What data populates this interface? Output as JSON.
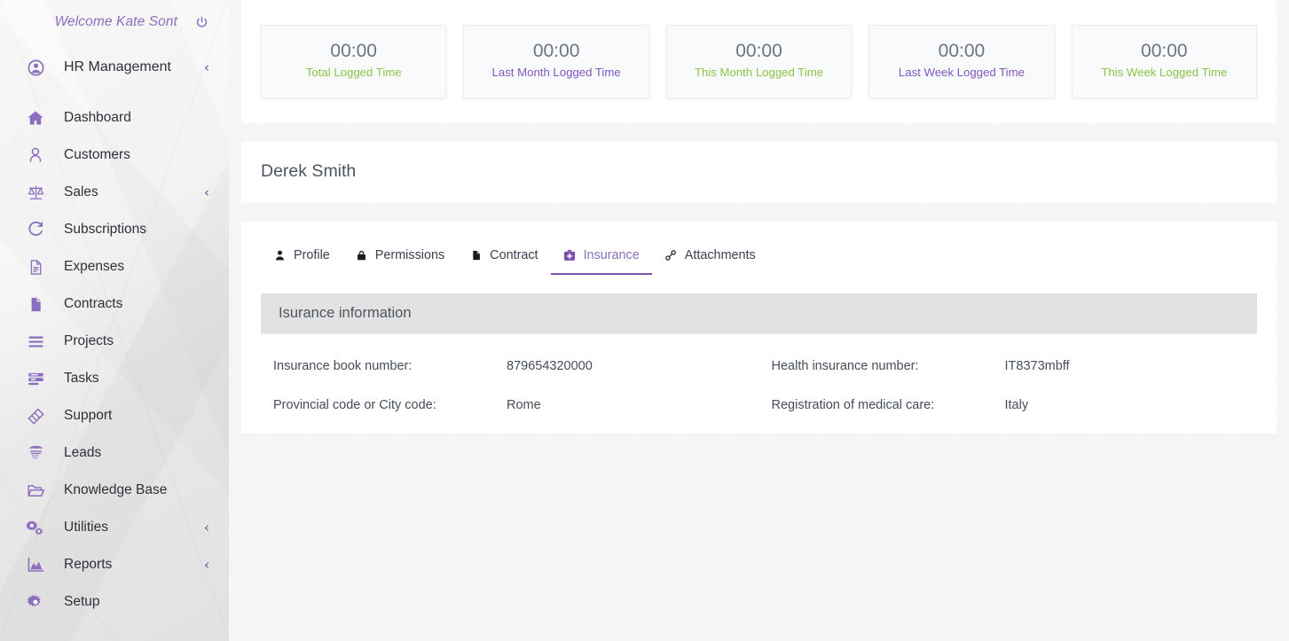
{
  "sidebar": {
    "welcome": "Welcome Kate Sont",
    "power_icon": "power-icon",
    "group": {
      "label": "HR Management",
      "icon": "user-circle-icon",
      "chevron": "‹"
    },
    "items": [
      {
        "label": "Dashboard",
        "icon": "home-icon",
        "chevron": ""
      },
      {
        "label": "Customers",
        "icon": "user-icon",
        "chevron": ""
      },
      {
        "label": "Sales",
        "icon": "scales-icon",
        "chevron": "‹"
      },
      {
        "label": "Subscriptions",
        "icon": "refresh-icon",
        "chevron": ""
      },
      {
        "label": "Expenses",
        "icon": "file-lines-icon",
        "chevron": ""
      },
      {
        "label": "Contracts",
        "icon": "document-icon",
        "chevron": ""
      },
      {
        "label": "Projects",
        "icon": "bars-icon",
        "chevron": ""
      },
      {
        "label": "Tasks",
        "icon": "tasks-icon",
        "chevron": ""
      },
      {
        "label": "Support",
        "icon": "ticket-icon",
        "chevron": ""
      },
      {
        "label": "Leads",
        "icon": "funnel-icon",
        "chevron": ""
      },
      {
        "label": "Knowledge Base",
        "icon": "folder-open-icon",
        "chevron": ""
      },
      {
        "label": "Utilities",
        "icon": "gears-icon",
        "chevron": "‹"
      },
      {
        "label": "Reports",
        "icon": "area-chart-icon",
        "chevron": "‹"
      },
      {
        "label": "Setup",
        "icon": "gear-icon",
        "chevron": ""
      }
    ]
  },
  "stats": [
    {
      "value": "00:00",
      "label": "Total Logged Time",
      "color": "#8bc34a"
    },
    {
      "value": "00:00",
      "label": "Last Month Logged Time",
      "color": "#7e57c2"
    },
    {
      "value": "00:00",
      "label": "This Month Logged Time",
      "color": "#8bc34a"
    },
    {
      "value": "00:00",
      "label": "Last Week Logged Time",
      "color": "#7e57c2"
    },
    {
      "value": "00:00",
      "label": "This Week Logged Time",
      "color": "#8bc34a"
    }
  ],
  "employee": {
    "name": "Derek Smith"
  },
  "tabs": [
    {
      "label": "Profile",
      "icon": "user-solid-icon",
      "active": false
    },
    {
      "label": "Permissions",
      "icon": "lock-icon",
      "active": false
    },
    {
      "label": "Contract",
      "icon": "file-icon",
      "active": false
    },
    {
      "label": "Insurance",
      "icon": "medkit-icon",
      "active": true
    },
    {
      "label": "Attachments",
      "icon": "paperclip-icon",
      "active": false
    }
  ],
  "insurance": {
    "section_title": "Isurance information",
    "rows": [
      [
        {
          "label": "Insurance book number:",
          "value": "879654320000"
        },
        {
          "label": "Health insurance number:",
          "value": "IT8373mbff"
        }
      ],
      [
        {
          "label": "Provincial code or City code:",
          "value": "Rome"
        },
        {
          "label": "Registration of medical care:",
          "value": "Italy"
        }
      ]
    ]
  },
  "theme": {
    "accent": "#8b6fbe",
    "accent_dark": "#7b52ab",
    "green": "#8bc34a",
    "purple": "#7e57c2"
  }
}
